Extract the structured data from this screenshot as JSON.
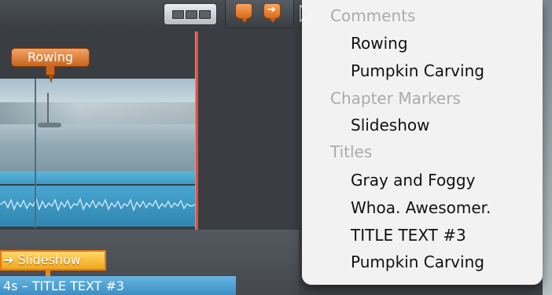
{
  "timeline": {
    "marker_label": "Rowing",
    "slideshow_label": "➔ Slideshow",
    "title_clip_label": "4s – TITLE TEXT #3"
  },
  "menu": {
    "sections": [
      {
        "title": "Comments",
        "items": [
          "Rowing",
          "Pumpkin Carving"
        ]
      },
      {
        "title": "Chapter Markers",
        "items": [
          "Slideshow"
        ]
      },
      {
        "title": "Titles",
        "items": [
          "Gray and Foggy",
          "Whoa. Awesomer.",
          "TITLE TEXT #3",
          "Pumpkin Carving"
        ]
      }
    ]
  },
  "colors": {
    "marker_orange": "#d86b1b",
    "chapter_yellow": "#f1a61a",
    "title_blue": "#3d8fc4",
    "playhead_red": "#e2503c"
  }
}
